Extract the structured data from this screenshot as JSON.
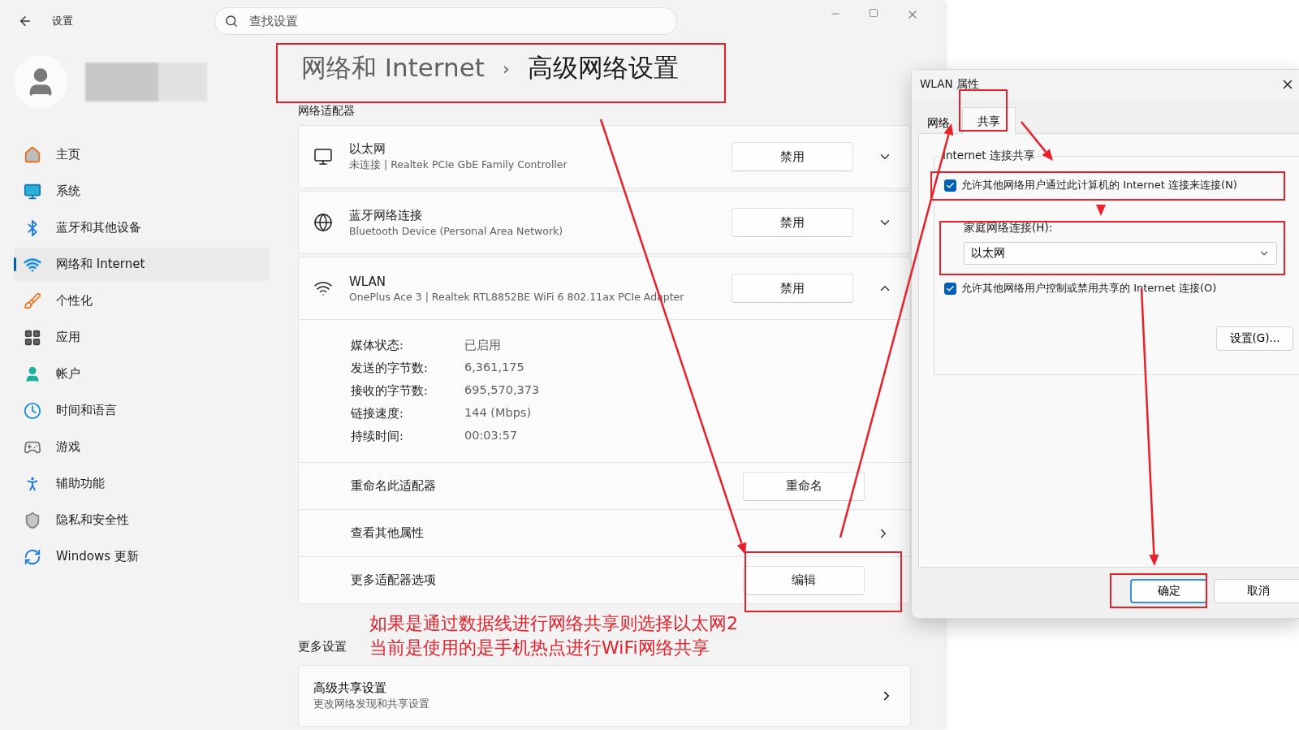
{
  "window": {
    "title": "设置",
    "search": {
      "placeholder": "查找设置"
    }
  },
  "sidebar": {
    "items": [
      {
        "label": "主页",
        "selected": false
      },
      {
        "label": "系统",
        "selected": false
      },
      {
        "label": "蓝牙和其他设备",
        "selected": false
      },
      {
        "label": "网络和 Internet",
        "selected": true
      },
      {
        "label": "个性化",
        "selected": false
      },
      {
        "label": "应用",
        "selected": false
      },
      {
        "label": "帐户",
        "selected": false
      },
      {
        "label": "时间和语言",
        "selected": false
      },
      {
        "label": "游戏",
        "selected": false
      },
      {
        "label": "辅助功能",
        "selected": false
      },
      {
        "label": "隐私和安全性",
        "selected": false
      },
      {
        "label": "Windows 更新",
        "selected": false
      }
    ]
  },
  "breadcrumb": {
    "parent": "网络和 Internet",
    "separator": "›",
    "current": "高级网络设置"
  },
  "adapters_heading": "网络适配器",
  "adapters": [
    {
      "name": "以太网",
      "description": "未连接 | Realtek PCIe GbE Family Controller",
      "button": "禁用",
      "expanded": false
    },
    {
      "name": "蓝牙网络连接",
      "description": "Bluetooth Device (Personal Area Network)",
      "button": "禁用",
      "expanded": false
    },
    {
      "name": "WLAN",
      "description": "OnePlus Ace 3 | Realtek RTL8852BE WiFi 6 802.11ax PCIe Adapter",
      "button": "禁用",
      "expanded": true,
      "details": [
        {
          "label": "媒体状态:",
          "value": "已启用"
        },
        {
          "label": "发送的字节数:",
          "value": "6,361,175"
        },
        {
          "label": "接收的字节数:",
          "value": "695,570,373"
        },
        {
          "label": "链接速度:",
          "value": "144 (Mbps)"
        },
        {
          "label": "持续时间:",
          "value": "00:03:57"
        }
      ],
      "options": [
        {
          "kind": "button",
          "label": "重命名此适配器",
          "button": "重命名"
        },
        {
          "kind": "link",
          "label": "查看其他属性"
        },
        {
          "kind": "button",
          "label": "更多适配器选项",
          "button": "编辑"
        }
      ]
    }
  ],
  "annotation_text": [
    "如果是通过数据线进行网络共享则选择以太网2",
    "当前是使用的是手机热点进行WiFi网络共享"
  ],
  "more_settings": {
    "heading": "更多设置",
    "items": [
      {
        "title": "高级共享设置",
        "subtitle": "更改网络发现和共享设置"
      }
    ]
  },
  "dialog": {
    "title": "WLAN 属性",
    "tabs": [
      {
        "label": "网络",
        "selected": false
      },
      {
        "label": "共享",
        "selected": true
      }
    ],
    "group_title": "Internet 连接共享",
    "allow_share": {
      "label": "允许其他网络用户通过此计算机的 Internet 连接来连接(N)",
      "checked": true
    },
    "home_connection": {
      "label": "家庭网络连接(H):",
      "value": "以太网"
    },
    "allow_control": {
      "label": "允许其他网络用户控制或禁用共享的 Internet 连接(O)",
      "checked": true
    },
    "settings_button": "设置(G)...",
    "buttons": [
      {
        "label": "确定",
        "default": true
      },
      {
        "label": "取消",
        "default": false
      }
    ]
  }
}
